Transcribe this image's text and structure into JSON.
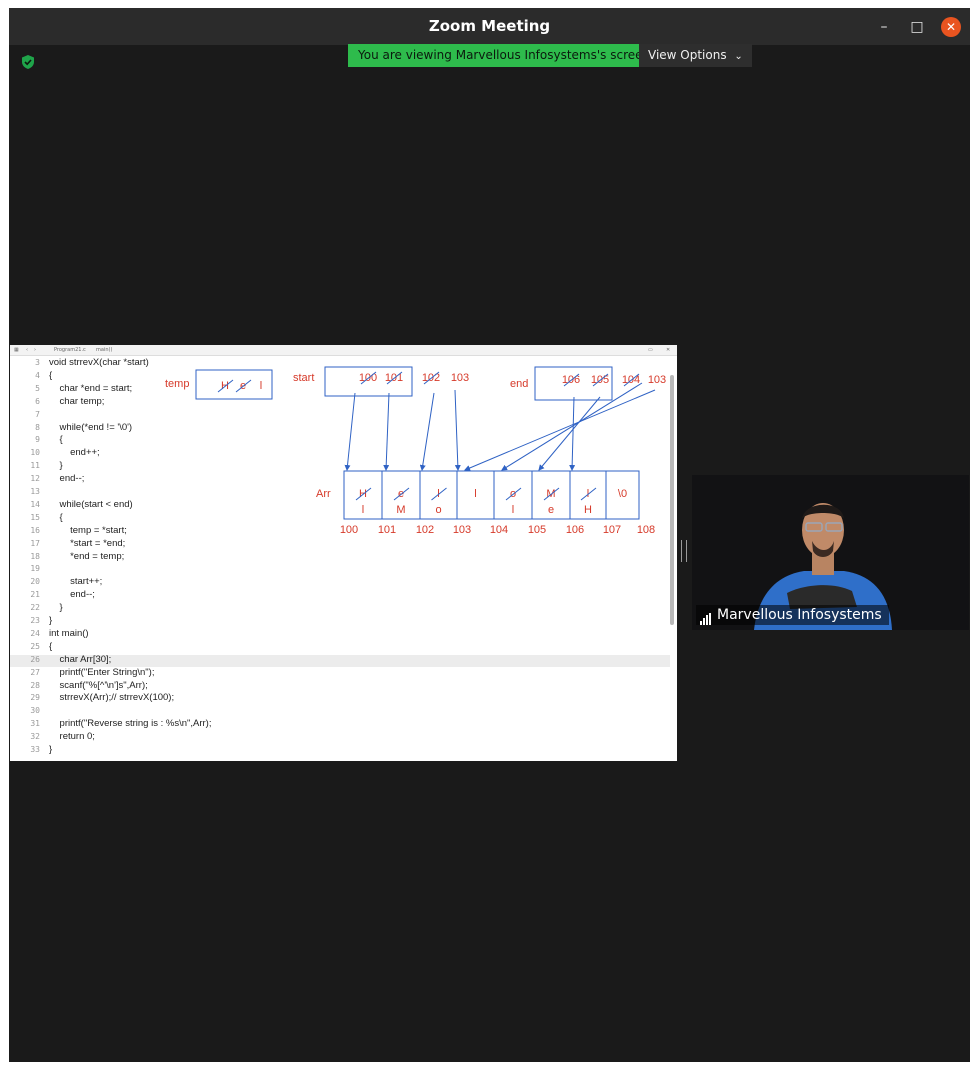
{
  "window": {
    "title": "Zoom Meeting"
  },
  "banner": {
    "viewing_text": "You are viewing Marvellous Infosystems's screen",
    "view_options": "View Options"
  },
  "editor": {
    "tab_path": "Program21.c",
    "tab_func": "main()",
    "lines": [
      {
        "n": "3",
        "t": "void strrevX(char *start)"
      },
      {
        "n": "4",
        "t": "{"
      },
      {
        "n": "5",
        "t": "    char *end = start;"
      },
      {
        "n": "6",
        "t": "    char temp;"
      },
      {
        "n": "7",
        "t": ""
      },
      {
        "n": "8",
        "t": "    while(*end != '\\0')"
      },
      {
        "n": "9",
        "t": "    {"
      },
      {
        "n": "10",
        "t": "        end++;"
      },
      {
        "n": "11",
        "t": "    }"
      },
      {
        "n": "12",
        "t": "    end--;"
      },
      {
        "n": "13",
        "t": ""
      },
      {
        "n": "14",
        "t": "    while(start < end)"
      },
      {
        "n": "15",
        "t": "    {"
      },
      {
        "n": "16",
        "t": "        temp = *start;"
      },
      {
        "n": "17",
        "t": "        *start = *end;"
      },
      {
        "n": "18",
        "t": "        *end = temp;"
      },
      {
        "n": "19",
        "t": ""
      },
      {
        "n": "20",
        "t": "        start++;"
      },
      {
        "n": "21",
        "t": "        end--;"
      },
      {
        "n": "22",
        "t": "    }"
      },
      {
        "n": "23",
        "t": "}"
      },
      {
        "n": "24",
        "t": "int main()"
      },
      {
        "n": "25",
        "t": "{"
      },
      {
        "n": "26",
        "t": "    char Arr[30];"
      },
      {
        "n": "27",
        "t": "    printf(\"Enter String\\n\");"
      },
      {
        "n": "28",
        "t": "    scanf(\"%[^'\\n']s\",Arr);"
      },
      {
        "n": "29",
        "t": "    strrevX(Arr);// strrevX(100);"
      },
      {
        "n": "30",
        "t": ""
      },
      {
        "n": "31",
        "t": "    printf(\"Reverse string is : %s\\n\",Arr);"
      },
      {
        "n": "32",
        "t": "    return 0;"
      },
      {
        "n": "33",
        "t": "}"
      }
    ]
  },
  "diagram": {
    "temp_label": "temp",
    "temp_values": [
      "H",
      "e",
      "l"
    ],
    "start_label": "start",
    "start_values": [
      "100",
      "101",
      "102",
      "103"
    ],
    "end_label": "end",
    "end_values": [
      "106",
      "105",
      "104",
      "103"
    ],
    "arr_label": "Arr",
    "cells": [
      {
        "old": "H",
        "new": "l",
        "addr": "100"
      },
      {
        "old": "e",
        "new": "M",
        "addr": "101"
      },
      {
        "old": "l",
        "new": "o",
        "addr": "102"
      },
      {
        "old": "",
        "new": "l",
        "addr": "103"
      },
      {
        "old": "o",
        "new": "l",
        "addr": "104"
      },
      {
        "old": "M",
        "new": "e",
        "addr": "105"
      },
      {
        "old": "l",
        "new": "H",
        "addr": "106"
      },
      {
        "old": "",
        "new": "\\0",
        "addr": "107"
      },
      {
        "old": "",
        "new": "",
        "addr": "108"
      }
    ],
    "ink_color": "#d63a2a",
    "box_color": "#2f62c4"
  },
  "participant": {
    "name": "Marvellous Infosystems"
  },
  "colors": {
    "banner_green": "#2ebb4c",
    "close_orange": "#e95420",
    "shield_green": "#1fa44a"
  },
  "icons": [
    "shield-icon",
    "minimize-icon",
    "maximize-icon",
    "close-icon",
    "chevron-down-icon",
    "signal-bars-icon"
  ]
}
